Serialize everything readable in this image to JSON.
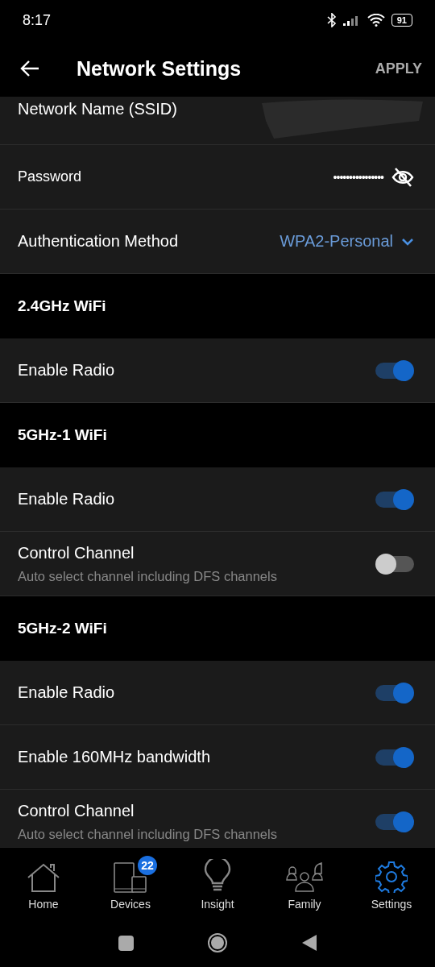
{
  "status_bar": {
    "time": "8:17",
    "battery": "91"
  },
  "header": {
    "title": "Network Settings",
    "action": "APPLY"
  },
  "items": [
    {
      "kind": "ssid",
      "label": "Network Name (SSID)"
    },
    {
      "kind": "password",
      "label": "Password",
      "value": "••••••••••••••••"
    },
    {
      "kind": "dropdown",
      "label": "Authentication Method",
      "value": "WPA2-Personal"
    },
    {
      "kind": "section",
      "label": "2.4GHz WiFi"
    },
    {
      "kind": "toggle",
      "label": "Enable Radio",
      "on": true
    },
    {
      "kind": "section",
      "label": "5GHz-1 WiFi"
    },
    {
      "kind": "toggle",
      "label": "Enable Radio",
      "on": true
    },
    {
      "kind": "toggle",
      "label": "Control Channel",
      "sub": "Auto select channel including DFS channels",
      "on": false
    },
    {
      "kind": "section",
      "label": "5GHz-2 WiFi"
    },
    {
      "kind": "toggle",
      "label": "Enable Radio",
      "on": true
    },
    {
      "kind": "toggle",
      "label": "Enable 160MHz bandwidth",
      "on": true
    },
    {
      "kind": "toggle",
      "label": "Control Channel",
      "sub": "Auto select channel including DFS channels",
      "on": true
    }
  ],
  "tabs": [
    {
      "label": "Home",
      "selected": false
    },
    {
      "label": "Devices",
      "badge": "22",
      "selected": false
    },
    {
      "label": "Insight",
      "selected": false
    },
    {
      "label": "Family",
      "selected": false
    },
    {
      "label": "Settings",
      "selected": true
    }
  ]
}
